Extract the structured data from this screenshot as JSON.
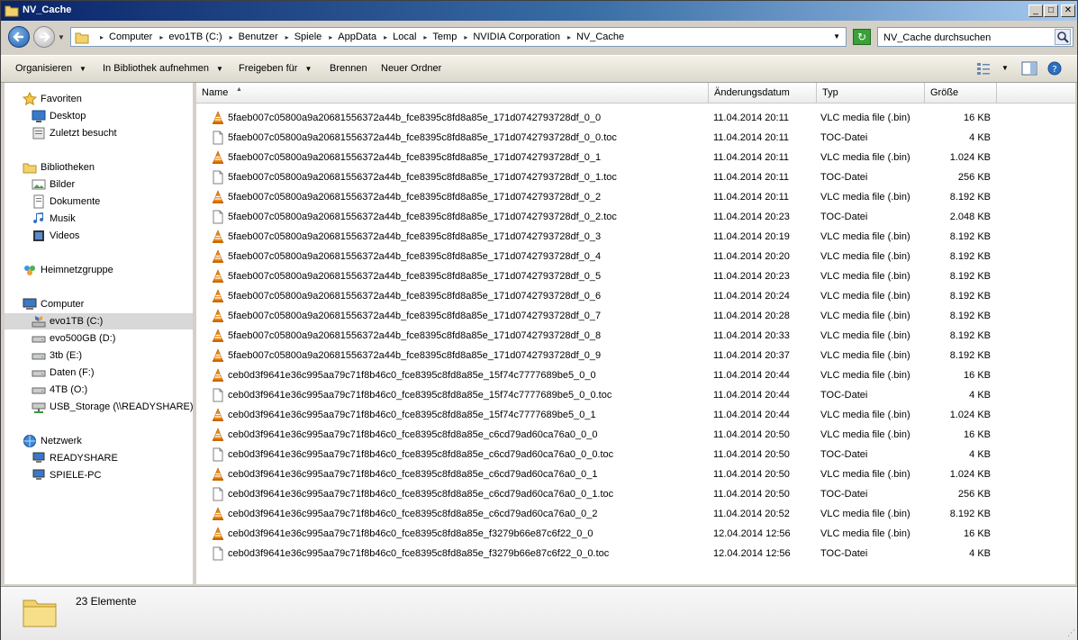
{
  "window": {
    "title": "NV_Cache",
    "controls": {
      "minimize": "_",
      "maximize": "□",
      "close": "✕"
    }
  },
  "address": {
    "crumbs": [
      "Computer",
      "evo1TB (C:)",
      "Benutzer",
      "Spiele",
      "AppData",
      "Local",
      "Temp",
      "NVIDIA Corporation",
      "NV_Cache"
    ]
  },
  "search": {
    "placeholder": "NV_Cache durchsuchen"
  },
  "toolbar": {
    "organize": "Organisieren",
    "library": "In Bibliothek aufnehmen",
    "share": "Freigeben für",
    "burn": "Brennen",
    "new_folder": "Neuer Ordner"
  },
  "nav": {
    "favorites": "Favoriten",
    "desktop": "Desktop",
    "recent": "Zuletzt besucht",
    "libraries": "Bibliotheken",
    "pictures": "Bilder",
    "documents": "Dokumente",
    "music": "Musik",
    "videos": "Videos",
    "homegroup": "Heimnetzgruppe",
    "computer": "Computer",
    "drives": [
      "evo1TB (C:)",
      "evo500GB (D:)",
      "3tb (E:)",
      "Daten (F:)",
      "4TB (O:)",
      "USB_Storage (\\\\READYSHARE) (Z"
    ],
    "network": "Netzwerk",
    "network_items": [
      "READYSHARE",
      "SPIELE-PC"
    ]
  },
  "columns": {
    "name": "Name",
    "date": "Änderungsdatum",
    "type": "Typ",
    "size": "Größe"
  },
  "files": [
    {
      "name": "5faeb007c05800a9a20681556372a44b_fce8395c8fd8a85e_171d0742793728df_0_0",
      "date": "11.04.2014 20:11",
      "type": "VLC media file (.bin)",
      "size": "16 KB",
      "icon": "vlc"
    },
    {
      "name": "5faeb007c05800a9a20681556372a44b_fce8395c8fd8a85e_171d0742793728df_0_0.toc",
      "date": "11.04.2014 20:11",
      "type": "TOC-Datei",
      "size": "4 KB",
      "icon": "file"
    },
    {
      "name": "5faeb007c05800a9a20681556372a44b_fce8395c8fd8a85e_171d0742793728df_0_1",
      "date": "11.04.2014 20:11",
      "type": "VLC media file (.bin)",
      "size": "1.024 KB",
      "icon": "vlc"
    },
    {
      "name": "5faeb007c05800a9a20681556372a44b_fce8395c8fd8a85e_171d0742793728df_0_1.toc",
      "date": "11.04.2014 20:11",
      "type": "TOC-Datei",
      "size": "256 KB",
      "icon": "file"
    },
    {
      "name": "5faeb007c05800a9a20681556372a44b_fce8395c8fd8a85e_171d0742793728df_0_2",
      "date": "11.04.2014 20:11",
      "type": "VLC media file (.bin)",
      "size": "8.192 KB",
      "icon": "vlc"
    },
    {
      "name": "5faeb007c05800a9a20681556372a44b_fce8395c8fd8a85e_171d0742793728df_0_2.toc",
      "date": "11.04.2014 20:23",
      "type": "TOC-Datei",
      "size": "2.048 KB",
      "icon": "file"
    },
    {
      "name": "5faeb007c05800a9a20681556372a44b_fce8395c8fd8a85e_171d0742793728df_0_3",
      "date": "11.04.2014 20:19",
      "type": "VLC media file (.bin)",
      "size": "8.192 KB",
      "icon": "vlc"
    },
    {
      "name": "5faeb007c05800a9a20681556372a44b_fce8395c8fd8a85e_171d0742793728df_0_4",
      "date": "11.04.2014 20:20",
      "type": "VLC media file (.bin)",
      "size": "8.192 KB",
      "icon": "vlc"
    },
    {
      "name": "5faeb007c05800a9a20681556372a44b_fce8395c8fd8a85e_171d0742793728df_0_5",
      "date": "11.04.2014 20:23",
      "type": "VLC media file (.bin)",
      "size": "8.192 KB",
      "icon": "vlc"
    },
    {
      "name": "5faeb007c05800a9a20681556372a44b_fce8395c8fd8a85e_171d0742793728df_0_6",
      "date": "11.04.2014 20:24",
      "type": "VLC media file (.bin)",
      "size": "8.192 KB",
      "icon": "vlc"
    },
    {
      "name": "5faeb007c05800a9a20681556372a44b_fce8395c8fd8a85e_171d0742793728df_0_7",
      "date": "11.04.2014 20:28",
      "type": "VLC media file (.bin)",
      "size": "8.192 KB",
      "icon": "vlc"
    },
    {
      "name": "5faeb007c05800a9a20681556372a44b_fce8395c8fd8a85e_171d0742793728df_0_8",
      "date": "11.04.2014 20:33",
      "type": "VLC media file (.bin)",
      "size": "8.192 KB",
      "icon": "vlc"
    },
    {
      "name": "5faeb007c05800a9a20681556372a44b_fce8395c8fd8a85e_171d0742793728df_0_9",
      "date": "11.04.2014 20:37",
      "type": "VLC media file (.bin)",
      "size": "8.192 KB",
      "icon": "vlc"
    },
    {
      "name": "ceb0d3f9641e36c995aa79c71f8b46c0_fce8395c8fd8a85e_15f74c7777689be5_0_0",
      "date": "11.04.2014 20:44",
      "type": "VLC media file (.bin)",
      "size": "16 KB",
      "icon": "vlc"
    },
    {
      "name": "ceb0d3f9641e36c995aa79c71f8b46c0_fce8395c8fd8a85e_15f74c7777689be5_0_0.toc",
      "date": "11.04.2014 20:44",
      "type": "TOC-Datei",
      "size": "4 KB",
      "icon": "file"
    },
    {
      "name": "ceb0d3f9641e36c995aa79c71f8b46c0_fce8395c8fd8a85e_15f74c7777689be5_0_1",
      "date": "11.04.2014 20:44",
      "type": "VLC media file (.bin)",
      "size": "1.024 KB",
      "icon": "vlc"
    },
    {
      "name": "ceb0d3f9641e36c995aa79c71f8b46c0_fce8395c8fd8a85e_c6cd79ad60ca76a0_0_0",
      "date": "11.04.2014 20:50",
      "type": "VLC media file (.bin)",
      "size": "16 KB",
      "icon": "vlc"
    },
    {
      "name": "ceb0d3f9641e36c995aa79c71f8b46c0_fce8395c8fd8a85e_c6cd79ad60ca76a0_0_0.toc",
      "date": "11.04.2014 20:50",
      "type": "TOC-Datei",
      "size": "4 KB",
      "icon": "file"
    },
    {
      "name": "ceb0d3f9641e36c995aa79c71f8b46c0_fce8395c8fd8a85e_c6cd79ad60ca76a0_0_1",
      "date": "11.04.2014 20:50",
      "type": "VLC media file (.bin)",
      "size": "1.024 KB",
      "icon": "vlc"
    },
    {
      "name": "ceb0d3f9641e36c995aa79c71f8b46c0_fce8395c8fd8a85e_c6cd79ad60ca76a0_0_1.toc",
      "date": "11.04.2014 20:50",
      "type": "TOC-Datei",
      "size": "256 KB",
      "icon": "file"
    },
    {
      "name": "ceb0d3f9641e36c995aa79c71f8b46c0_fce8395c8fd8a85e_c6cd79ad60ca76a0_0_2",
      "date": "11.04.2014 20:52",
      "type": "VLC media file (.bin)",
      "size": "8.192 KB",
      "icon": "vlc"
    },
    {
      "name": "ceb0d3f9641e36c995aa79c71f8b46c0_fce8395c8fd8a85e_f3279b66e87c6f22_0_0",
      "date": "12.04.2014 12:56",
      "type": "VLC media file (.bin)",
      "size": "16 KB",
      "icon": "vlc"
    },
    {
      "name": "ceb0d3f9641e36c995aa79c71f8b46c0_fce8395c8fd8a85e_f3279b66e87c6f22_0_0.toc",
      "date": "12.04.2014 12:56",
      "type": "TOC-Datei",
      "size": "4 KB",
      "icon": "file"
    }
  ],
  "status": {
    "count": "23 Elemente"
  },
  "colors": {
    "vlc_orange": "#f28a0f",
    "title_blue": "#0a246a",
    "selection": "#d8d8d8"
  }
}
